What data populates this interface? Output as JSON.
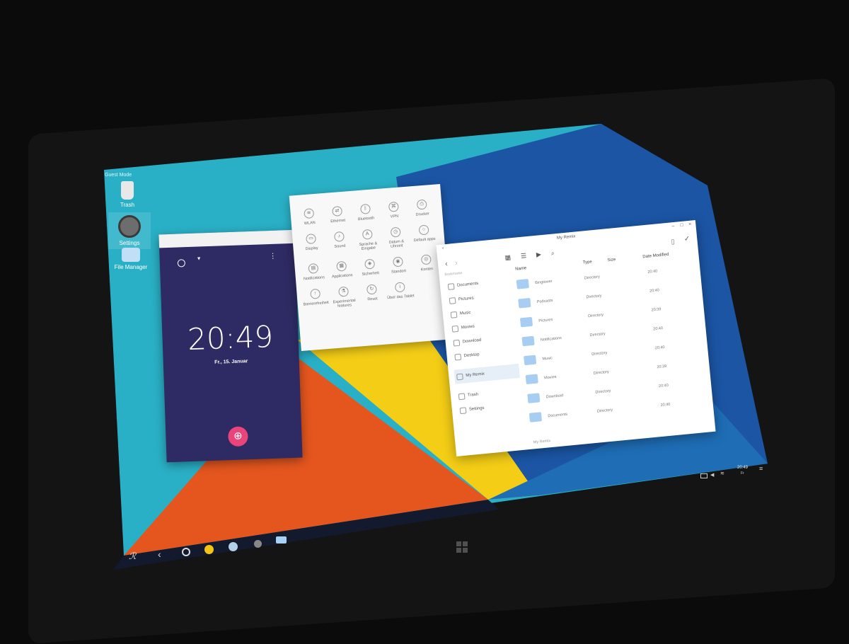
{
  "desktop": {
    "mode_label": "Guest Mode",
    "icons": [
      {
        "label": "Trash",
        "icon": "trash-icon"
      },
      {
        "label": "Settings",
        "icon": "gear-icon"
      },
      {
        "label": "File Manager",
        "icon": "folder-icon"
      }
    ]
  },
  "clock_app": {
    "time": "20:49",
    "date": "Fr., 15. Januar",
    "fab_icon": "globe-icon"
  },
  "settings_app": {
    "items": [
      "WLAN",
      "Ethernet",
      "Bluetooth",
      "VPN",
      "Drucker",
      "Display",
      "Sound",
      "Sprache & Eingabe",
      "Datum & Uhrzeit",
      "Default apps",
      "Notifications",
      "Applications",
      "Sicherheit",
      "Standort",
      "Konten",
      "Barrierefreiheit",
      "Experimental features",
      "Reset",
      "Über das Tablet"
    ]
  },
  "file_manager": {
    "title": "My Remix",
    "sidebar": {
      "section": "Bookmarks",
      "items": [
        "Documents",
        "Pictures",
        "Music",
        "Movies",
        "Download",
        "Desktop",
        "My Remix",
        "Trash",
        "Settings"
      ]
    },
    "columns": {
      "name": "Name",
      "type": "Type",
      "size": "Size",
      "date": "Date Modified"
    },
    "rows": [
      {
        "name": "Bingtower",
        "type": "Directory",
        "time": "20:40"
      },
      {
        "name": "Podcasts",
        "type": "Directory",
        "time": "20:40"
      },
      {
        "name": "Pictures",
        "type": "Directory",
        "time": "20:39"
      },
      {
        "name": "Notifications",
        "type": "Directory",
        "time": "20:40"
      },
      {
        "name": "Music",
        "type": "Directory",
        "time": "20:40"
      },
      {
        "name": "Movies",
        "type": "Directory",
        "time": "20:39"
      },
      {
        "name": "Download",
        "type": "Directory",
        "time": "20:40"
      },
      {
        "name": "Documents",
        "type": "Directory",
        "time": "20:40"
      }
    ],
    "footer": "My Remix"
  },
  "tray": {
    "time": "20:49",
    "day": "Fr"
  },
  "colors": {
    "teal": "#2ab0c6",
    "navy": "#1b55a4",
    "orange": "#e4561e",
    "yellow": "#f3cd16",
    "clock_bg": "#2e2a63",
    "fab": "#e9457b"
  }
}
